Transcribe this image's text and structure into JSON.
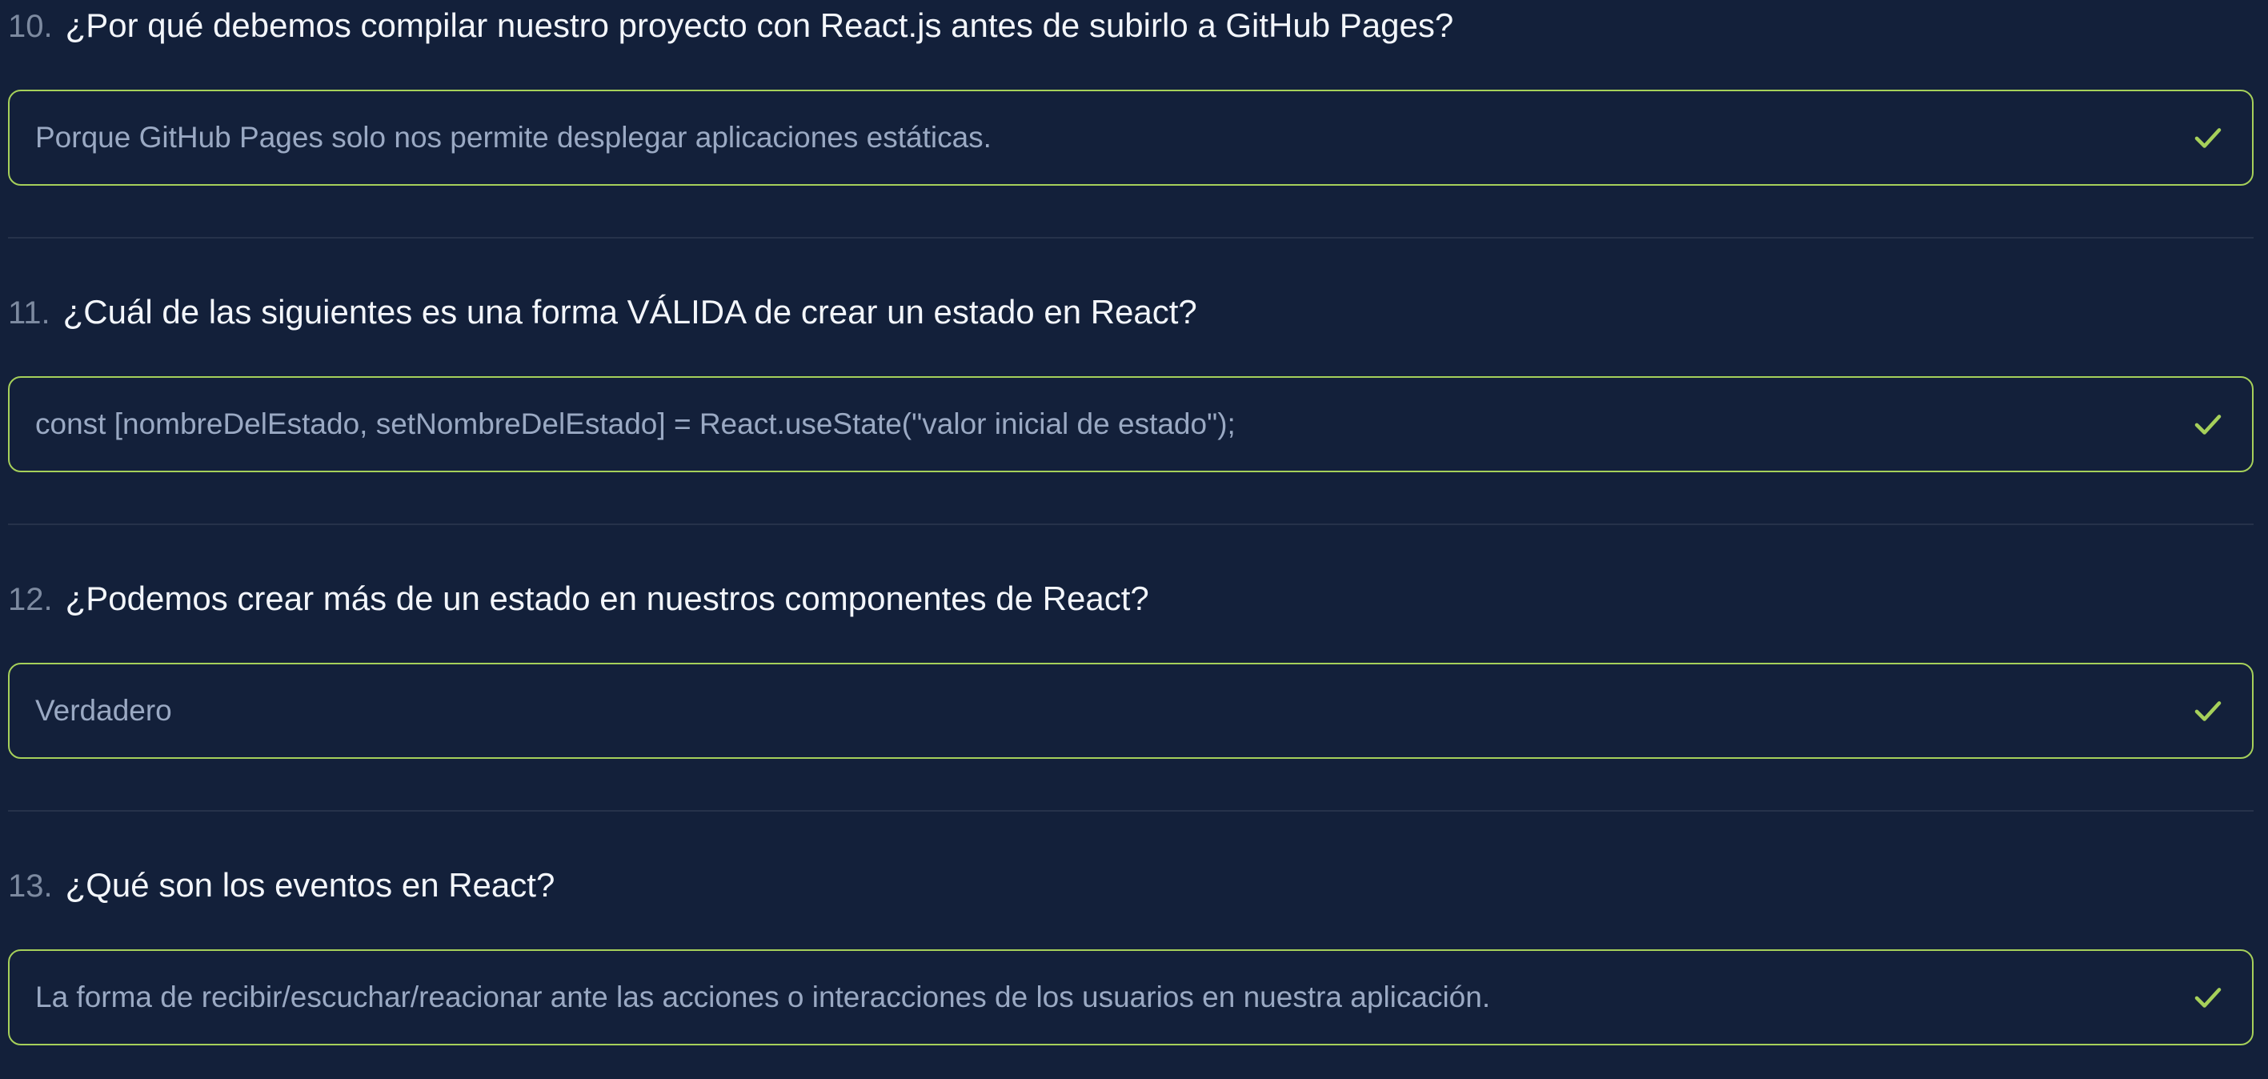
{
  "colors": {
    "background": "#13203a",
    "answer_border": "#a6d05a",
    "check": "#a6d05a",
    "question_text": "#f3f6fb",
    "answer_text": "#9aa9c3",
    "number_text": "#7d8aa0"
  },
  "questions": [
    {
      "number": "10.",
      "text": "¿Por qué debemos compilar nuestro proyecto con React.js antes de subirlo a GitHub Pages?",
      "answer": "Porque GitHub Pages solo nos permite desplegar aplicaciones estáticas.",
      "icon": "check-icon"
    },
    {
      "number": "11.",
      "text": "¿Cuál de las siguientes es una forma VÁLIDA de crear un estado en React?",
      "answer": "const [nombreDelEstado, setNombreDelEstado] = React.useState(\"valor inicial de estado\");",
      "icon": "check-icon"
    },
    {
      "number": "12.",
      "text": "¿Podemos crear más de un estado en nuestros componentes de React?",
      "answer": "Verdadero",
      "icon": "check-icon"
    },
    {
      "number": "13.",
      "text": "¿Qué son los eventos en React?",
      "answer": "La forma de recibir/escuchar/reacionar ante las acciones o interacciones de los usuarios en nuestra aplicación.",
      "icon": "check-icon"
    }
  ]
}
